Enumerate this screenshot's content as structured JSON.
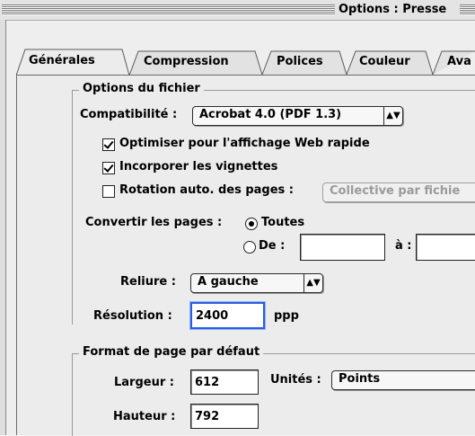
{
  "window": {
    "title": "Options : Presse"
  },
  "tabs": [
    {
      "label": "Générales",
      "selected": true
    },
    {
      "label": "Compression",
      "selected": false
    },
    {
      "label": "Polices",
      "selected": false
    },
    {
      "label": "Couleur",
      "selected": false
    },
    {
      "label": "Ava",
      "selected": false
    }
  ],
  "file_options": {
    "title": "Options du fichier",
    "compat_label": "Compatibilité :",
    "compat_value": "Acrobat 4.0 (PDF 1.3)",
    "optimize_label": "Optimiser pour l'affichage Web rapide",
    "optimize_checked": true,
    "thumbnails_label": "Incorporer les vignettes",
    "thumbnails_checked": true,
    "rotate_label": "Rotation auto. des pages :",
    "rotate_checked": false,
    "rotate_value": "Collective par fichie",
    "convert_label": "Convertir les pages :",
    "all_label": "Toutes",
    "all_selected": true,
    "from_label": "De :",
    "to_label": "à :",
    "from_value": "",
    "to_value": "",
    "binding_label": "Reliure :",
    "binding_value": "A gauche",
    "resolution_label": "Résolution :",
    "resolution_value": "2400",
    "resolution_unit": "ppp"
  },
  "page_format": {
    "title": "Format de page par défaut",
    "width_label": "Largeur :",
    "width_value": "612",
    "units_label": "Unités :",
    "units_value": "Points",
    "height_label": "Hauteur :",
    "height_value": "792"
  },
  "colors": {
    "focus": "#2a5fd8",
    "window_bg": "#eeeeee"
  }
}
